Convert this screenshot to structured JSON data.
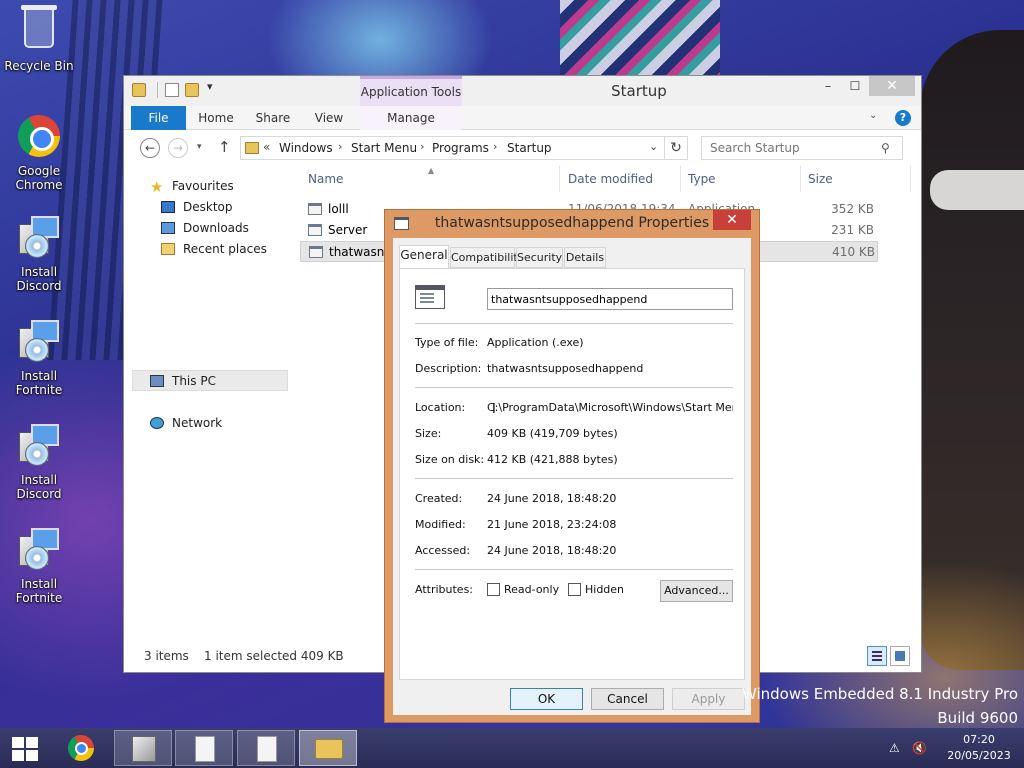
{
  "desktop": {
    "icons": [
      {
        "label": "Recycle Bin",
        "icon": "recycle-bin-icon"
      },
      {
        "label": "Google Chrome",
        "icon": "chrome-icon"
      },
      {
        "label": "Install Discord",
        "icon": "setup-icon"
      },
      {
        "label": "Install Fortnite",
        "icon": "setup-icon"
      },
      {
        "label": "Install Discord",
        "icon": "setup-icon"
      },
      {
        "label": "Install Fortnite",
        "icon": "setup-icon"
      }
    ]
  },
  "explorer": {
    "title": "Startup",
    "context_tab_header": "Application Tools",
    "window_controls": {
      "minimize": "–",
      "maximize": "☐",
      "close": "✕"
    },
    "ribbon_tabs": {
      "file": "File",
      "home": "Home",
      "share": "Share",
      "view": "View",
      "manage": "Manage"
    },
    "ribbon_collapse": "⌄",
    "help": "?",
    "nav": {
      "back": "←",
      "forward": "→",
      "recent": "▾",
      "up": "↑"
    },
    "address": {
      "chevron": "«",
      "crumbs": [
        "Windows",
        "Start Menu",
        "Programs",
        "Startup"
      ],
      "separator": "›",
      "dropdown": "⌄",
      "refresh": "↻"
    },
    "search": {
      "placeholder": "Search Startup"
    },
    "nav_pane": {
      "favourites": "Favourites",
      "desktop": "Desktop",
      "downloads": "Downloads",
      "recent": "Recent places",
      "this_pc": "This PC",
      "network": "Network"
    },
    "columns": {
      "name": "Name",
      "date": "Date modified",
      "type": "Type",
      "size": "Size"
    },
    "files": [
      {
        "name": "lolll",
        "date": "11/06/2018 19:34",
        "type": "Application",
        "size": "352 KB"
      },
      {
        "name": "Server",
        "date": "",
        "type": "",
        "size": "231 KB"
      },
      {
        "name": "thatwasntsupposedhappend",
        "date": "",
        "type": "",
        "size": "410 KB"
      }
    ],
    "status": {
      "items": "3 items",
      "selected": "1 item selected  409 KB"
    }
  },
  "properties": {
    "title": "thatwasntsupposedhappend Properties",
    "close": "✕",
    "tabs": {
      "general": "General",
      "compatibility": "Compatibility",
      "security": "Security",
      "details": "Details"
    },
    "file_name": "thatwasntsupposedhappend",
    "labels": {
      "type": "Type of file:",
      "description": "Description:",
      "location": "Location:",
      "size": "Size:",
      "size_on_disk": "Size on disk:",
      "created": "Created:",
      "modified": "Modified:",
      "accessed": "Accessed:",
      "attributes": "Attributes:"
    },
    "values": {
      "type": "Application (.exe)",
      "description": "thatwasntsupposedhappend",
      "location": "C:\\ProgramData\\Microsoft\\Windows\\Start Menu\\Pr",
      "size": "409 KB (419,709 bytes)",
      "size_on_disk": "412 KB (421,888 bytes)",
      "created": "24 June 2018, 18:48:20",
      "modified": "21 June 2018, 23:24:08",
      "accessed": "24 June 2018, 18:48:20"
    },
    "attributes": {
      "read_only": "Read-only",
      "hidden": "Hidden",
      "advanced": "Advanced..."
    },
    "buttons": {
      "ok": "OK",
      "cancel": "Cancel",
      "apply": "Apply"
    }
  },
  "watermark": {
    "line1": "Windows Embedded 8.1 Industry Pro",
    "line2": "Build 9600"
  },
  "taskbar": {
    "tray": {
      "network": "⚠",
      "volume": "🔇"
    },
    "time": "07:20",
    "date": "20/05/2023"
  }
}
